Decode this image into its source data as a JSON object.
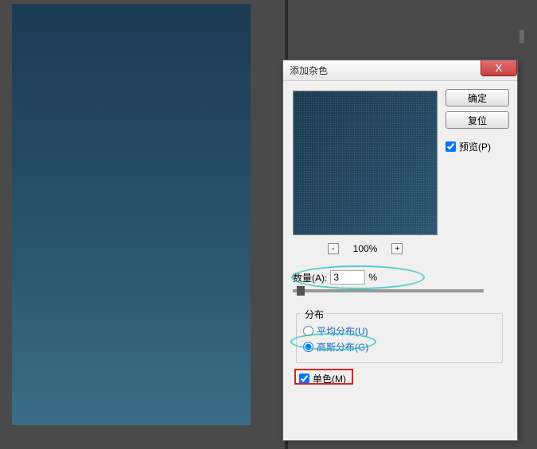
{
  "dialog": {
    "title": "添加杂色",
    "close": "X",
    "ok_label": "确定",
    "reset_label": "复位",
    "preview_checkbox_label": "预览(P)",
    "preview_checked": true
  },
  "zoom": {
    "minus": "-",
    "plus": "+",
    "percent": "100%"
  },
  "amount": {
    "label": "数量(A):",
    "value": "3",
    "unit": "%"
  },
  "distribution": {
    "legend": "分布",
    "uniform_label": "平均分布(U)",
    "gaussian_label": "高斯分布(G)",
    "selected": "gaussian"
  },
  "mono": {
    "label": "单色(M)",
    "checked": true
  }
}
